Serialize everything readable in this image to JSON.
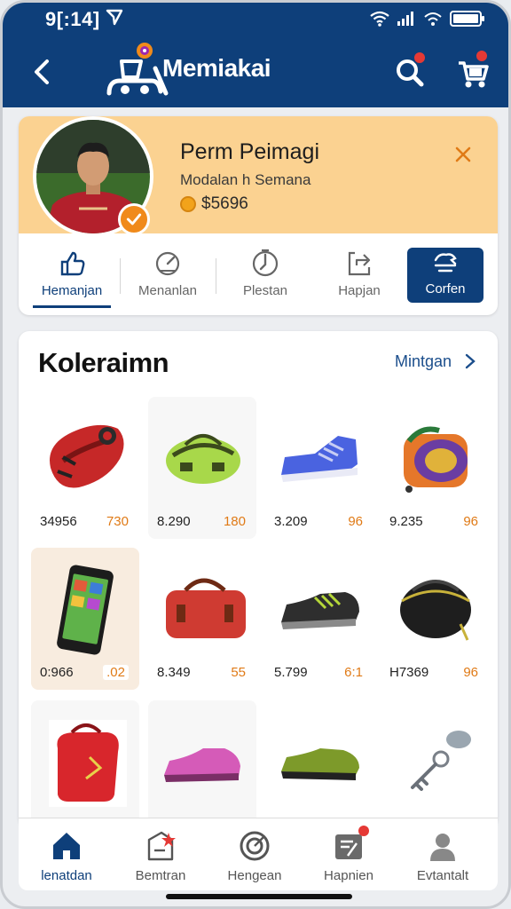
{
  "status": {
    "time": "9[:14]"
  },
  "header": {
    "brand": "Memiakai",
    "colors": {
      "primary": "#0e3f7a",
      "accent": "#f08a1b",
      "badge": "#e53935"
    }
  },
  "profile": {
    "name": "Perm Peimagi",
    "subtitle": "Modalan h Semana",
    "coins": "$5696",
    "tabs": [
      {
        "label": "Hemanjan",
        "icon": "thumb-up-icon",
        "active": true
      },
      {
        "label": "Menanlan",
        "icon": "gauge-icon"
      },
      {
        "label": "Plestan",
        "icon": "timer-icon"
      },
      {
        "label": "Hapjan",
        "icon": "share-box-icon"
      },
      {
        "label": "Corfen",
        "icon": "settings-icon",
        "primary": true
      }
    ]
  },
  "collection": {
    "title": "Koleraimn",
    "more_label": "Mintgan",
    "items": [
      {
        "icon": "red-backpack-icon",
        "price": "34956",
        "qty": "730"
      },
      {
        "icon": "green-duffel-bag-icon",
        "price": "8.290",
        "qty": "180"
      },
      {
        "icon": "blue-sneaker-icon",
        "price": "3.209",
        "qty": "96"
      },
      {
        "icon": "colorful-backpack-icon",
        "price": "9.235",
        "qty": "96"
      },
      {
        "icon": "smartphone-icon",
        "price": "0:966",
        "qty": ".02"
      },
      {
        "icon": "red-duffel-bag-icon",
        "price": "8.349",
        "qty": "55"
      },
      {
        "icon": "black-sneaker-icon",
        "price": "5.799",
        "qty": "6:1"
      },
      {
        "icon": "black-gym-bag-icon",
        "price": "H7369",
        "qty": "96"
      },
      {
        "icon": "red-school-bag-icon",
        "price": "",
        "qty": ""
      },
      {
        "icon": "pink-shoe-icon",
        "price": "",
        "qty": ""
      },
      {
        "icon": "green-shoe-icon",
        "price": "",
        "qty": ""
      },
      {
        "icon": "keychain-icon",
        "price": "",
        "qty": ""
      }
    ]
  },
  "bottom_nav": [
    {
      "label": "lenatdan",
      "icon": "home-icon",
      "active": true
    },
    {
      "label": "Bemtran",
      "icon": "star-tag-icon"
    },
    {
      "label": "Hengean",
      "icon": "target-icon"
    },
    {
      "label": "Hapnien",
      "icon": "inbox-icon"
    },
    {
      "label": "Evtantalt",
      "icon": "user-icon"
    }
  ]
}
